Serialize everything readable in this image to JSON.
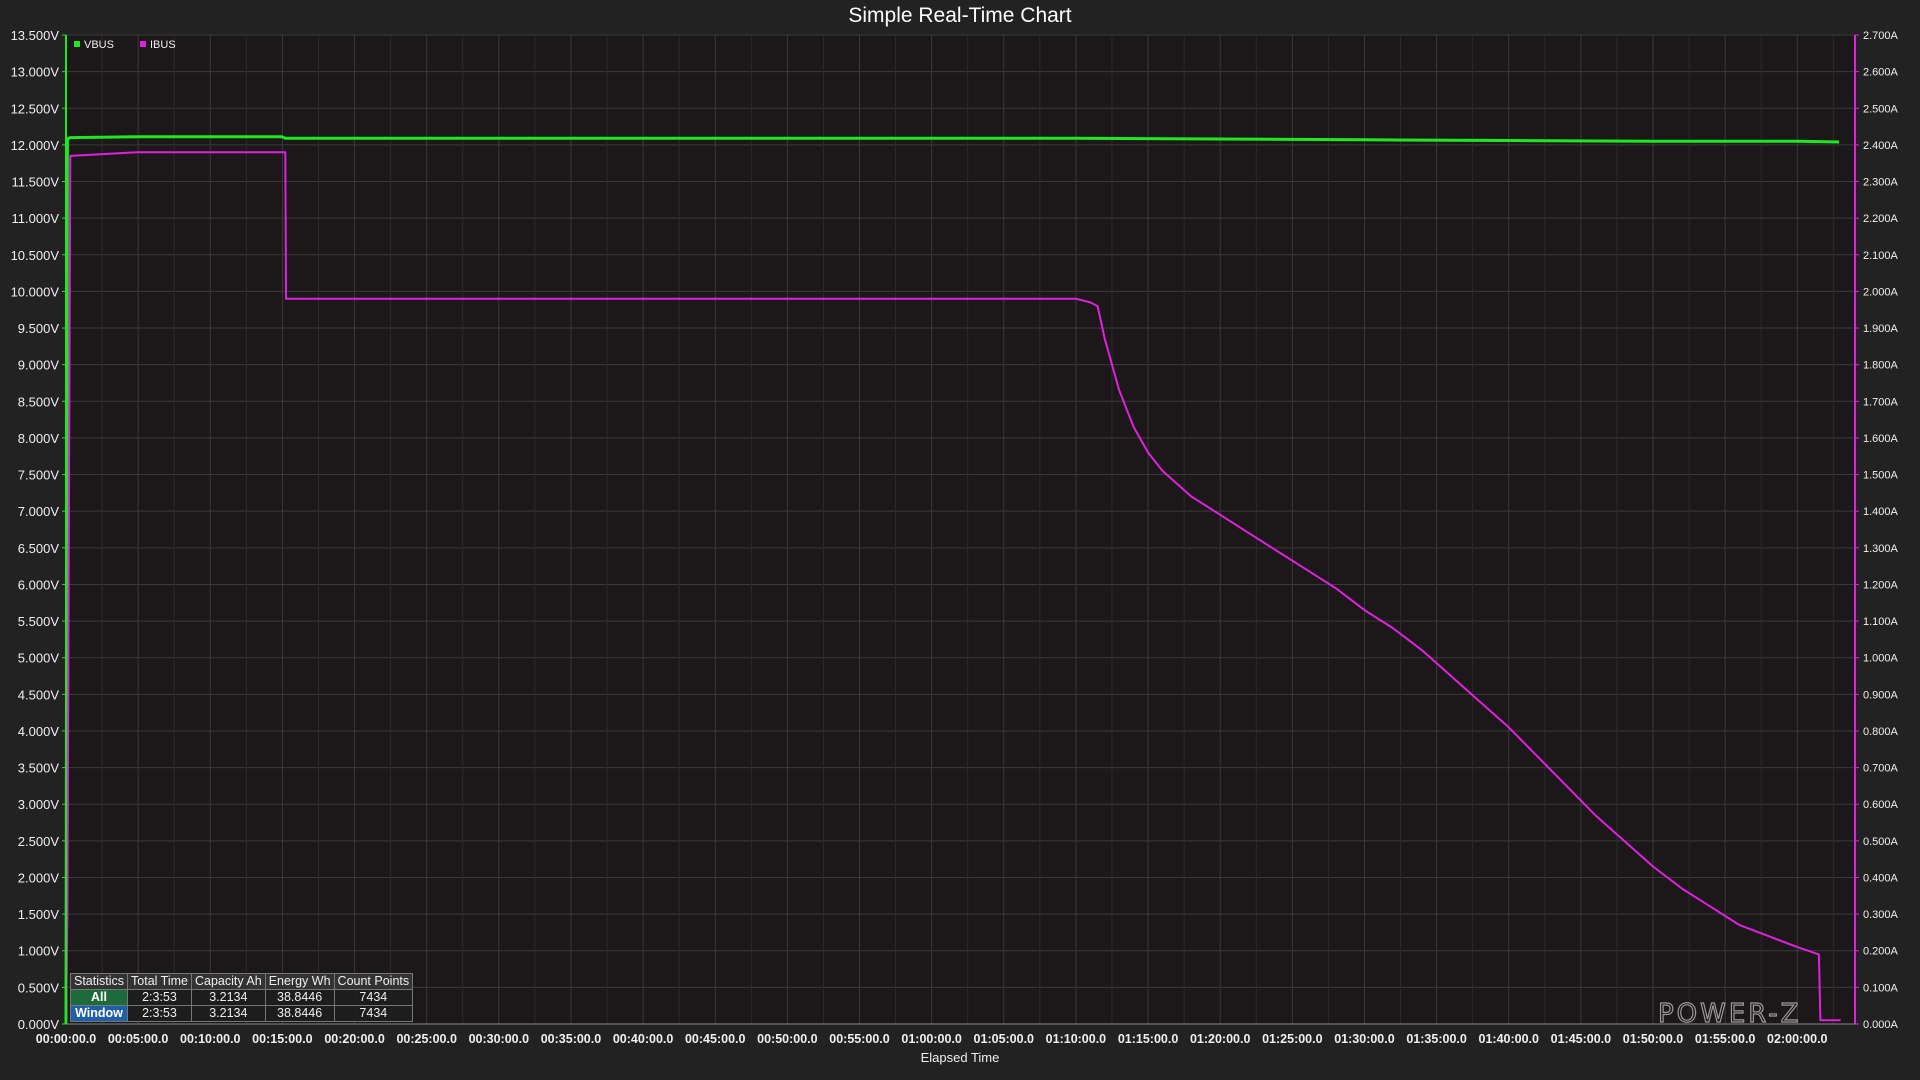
{
  "colors": {
    "background": "#222222",
    "plot_background": "#1c1719",
    "grid": "#3a3a3a",
    "vbus": "#1ee81e",
    "ibus": "#e020e0",
    "text": "#f0f0f0"
  },
  "watermark": "POWER-Z",
  "statistics": {
    "headers": [
      "Statistics",
      "Total Time",
      "Capacity Ah",
      "Energy Wh",
      "Count Points"
    ],
    "rows": [
      {
        "label": "All",
        "total_time": "2:3:53",
        "capacity": "3.2134",
        "energy": "38.8446",
        "count": "7434"
      },
      {
        "label": "Window",
        "total_time": "2:3:53",
        "capacity": "3.2134",
        "energy": "38.8446",
        "count": "7434"
      }
    ]
  },
  "chart_data": {
    "type": "line",
    "title": "Simple Real-Time Chart",
    "xlabel": "Elapsed Time",
    "ylabel": "",
    "y2label": "",
    "x_unit": "minutes",
    "xlim": [
      0,
      124
    ],
    "ylim": [
      0,
      13.5
    ],
    "y2lim": [
      0,
      2.7
    ],
    "grid": true,
    "legend_position": "top-left",
    "x_ticks": [
      "00:00:00.0",
      "00:05:00.0",
      "00:10:00.0",
      "00:15:00.0",
      "00:20:00.0",
      "00:25:00.0",
      "00:30:00.0",
      "00:35:00.0",
      "00:40:00.0",
      "00:45:00.0",
      "00:50:00.0",
      "00:55:00.0",
      "01:00:00.0",
      "01:05:00.0",
      "01:10:00.0",
      "01:15:00.0",
      "01:20:00.0",
      "01:25:00.0",
      "01:30:00.0",
      "01:35:00.0",
      "01:40:00.0",
      "01:45:00.0",
      "01:50:00.0",
      "01:55:00.0",
      "02:00:00.0"
    ],
    "y_ticks": [
      "0.000V",
      "0.500V",
      "1.000V",
      "1.500V",
      "2.000V",
      "2.500V",
      "3.000V",
      "3.500V",
      "4.000V",
      "4.500V",
      "5.000V",
      "5.500V",
      "6.000V",
      "6.500V",
      "7.000V",
      "7.500V",
      "8.000V",
      "8.500V",
      "9.000V",
      "9.500V",
      "10.000V",
      "10.500V",
      "11.000V",
      "11.500V",
      "12.000V",
      "12.500V",
      "13.000V",
      "13.500V"
    ],
    "y2_ticks": [
      "0.000A",
      "0.100A",
      "0.200A",
      "0.300A",
      "0.400A",
      "0.500A",
      "0.600A",
      "0.700A",
      "0.800A",
      "0.900A",
      "1.000A",
      "1.100A",
      "1.200A",
      "1.300A",
      "1.400A",
      "1.500A",
      "1.600A",
      "1.700A",
      "1.800A",
      "1.900A",
      "2.000A",
      "2.100A",
      "2.200A",
      "2.300A",
      "2.400A",
      "2.500A",
      "2.600A",
      "2.700A"
    ],
    "series": [
      {
        "name": "VBUS",
        "axis": "left",
        "x": [
          0,
          0.1,
          0.3,
          5,
          10,
          15,
          15.2,
          20,
          30,
          40,
          50,
          60,
          70,
          80,
          90,
          100,
          110,
          120,
          122.9
        ],
        "y": [
          0,
          12.08,
          12.1,
          12.11,
          12.11,
          12.11,
          12.09,
          12.09,
          12.09,
          12.09,
          12.09,
          12.09,
          12.09,
          12.08,
          12.07,
          12.06,
          12.05,
          12.05,
          12.04
        ]
      },
      {
        "name": "IBUS",
        "axis": "right",
        "x": [
          0,
          0.1,
          0.3,
          5,
          10,
          15.2,
          15.25,
          20,
          30,
          40,
          50,
          60,
          70,
          71,
          71.5,
          72,
          73,
          74,
          75,
          76,
          78,
          80,
          82,
          84,
          86,
          88,
          90,
          92,
          94,
          96,
          98,
          100,
          102,
          104,
          106,
          108,
          110,
          112,
          114,
          116,
          118,
          120,
          121.5,
          121.6,
          123
        ],
        "y": [
          0,
          0.3,
          2.37,
          2.38,
          2.38,
          2.38,
          1.98,
          1.98,
          1.98,
          1.98,
          1.98,
          1.98,
          1.98,
          1.97,
          1.96,
          1.87,
          1.73,
          1.63,
          1.56,
          1.51,
          1.44,
          1.39,
          1.34,
          1.29,
          1.24,
          1.19,
          1.13,
          1.08,
          1.02,
          0.95,
          0.88,
          0.81,
          0.73,
          0.65,
          0.57,
          0.5,
          0.43,
          0.37,
          0.32,
          0.27,
          0.24,
          0.21,
          0.19,
          0.01,
          0.01
        ]
      }
    ]
  }
}
